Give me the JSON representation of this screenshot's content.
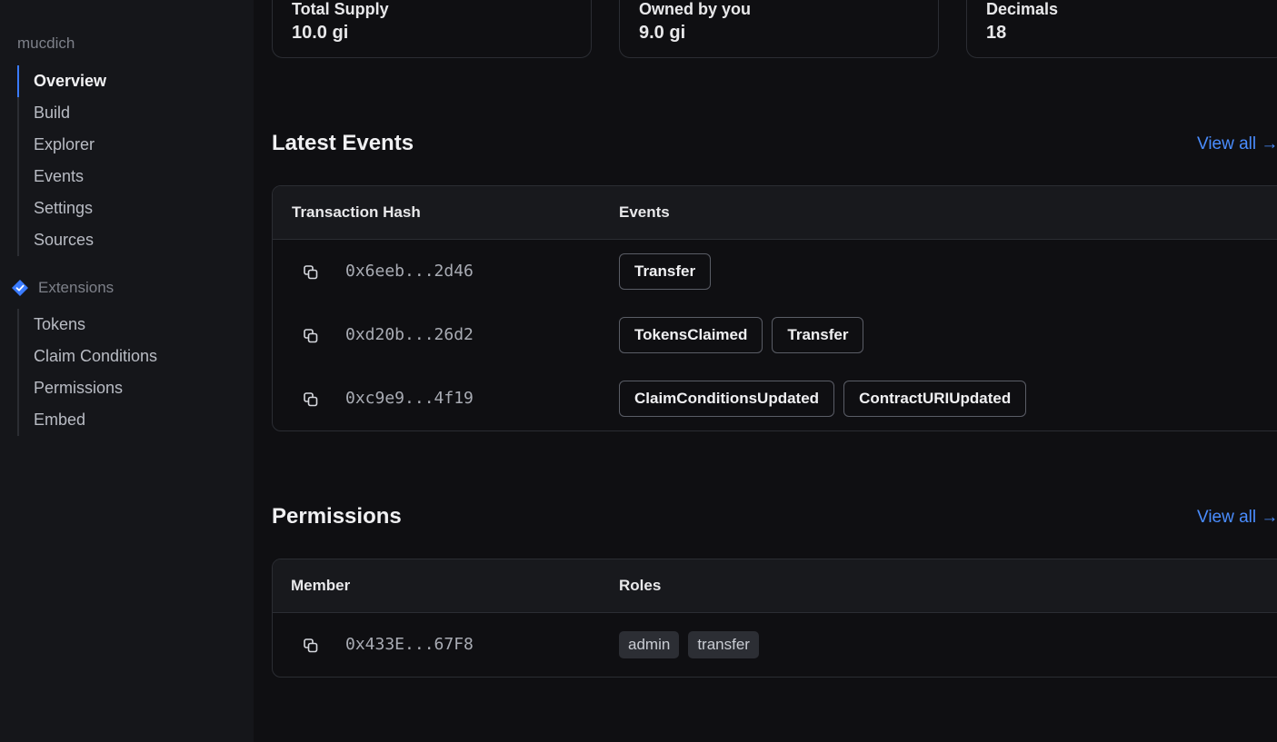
{
  "sidebar": {
    "title": "mucdich",
    "nav": [
      "Overview",
      "Build",
      "Explorer",
      "Events",
      "Settings",
      "Sources"
    ],
    "extensions_label": "Extensions",
    "extensions": [
      "Tokens",
      "Claim Conditions",
      "Permissions",
      "Embed"
    ]
  },
  "stats": [
    {
      "label": "Total Supply",
      "value": "10.0 gi"
    },
    {
      "label": "Owned by you",
      "value": "9.0 gi"
    },
    {
      "label": "Decimals",
      "value": "18"
    }
  ],
  "events": {
    "title": "Latest Events",
    "view_all": "View all →",
    "columns": [
      "Transaction Hash",
      "Events"
    ],
    "rows": [
      {
        "hash": "0x6eeb...2d46",
        "events": [
          "Transfer"
        ]
      },
      {
        "hash": "0xd20b...26d2",
        "events": [
          "TokensClaimed",
          "Transfer"
        ]
      },
      {
        "hash": "0xc9e9...4f19",
        "events": [
          "ClaimConditionsUpdated",
          "ContractURIUpdated"
        ]
      }
    ]
  },
  "permissions": {
    "title": "Permissions",
    "view_all": "View all →",
    "columns": [
      "Member",
      "Roles"
    ],
    "rows": [
      {
        "member": "0x433E...67F8",
        "roles": [
          "admin",
          "transfer"
        ]
      }
    ]
  },
  "colors": {
    "accent": "#3a7bff",
    "link": "#4a8dff",
    "background": "#0f0f12"
  }
}
